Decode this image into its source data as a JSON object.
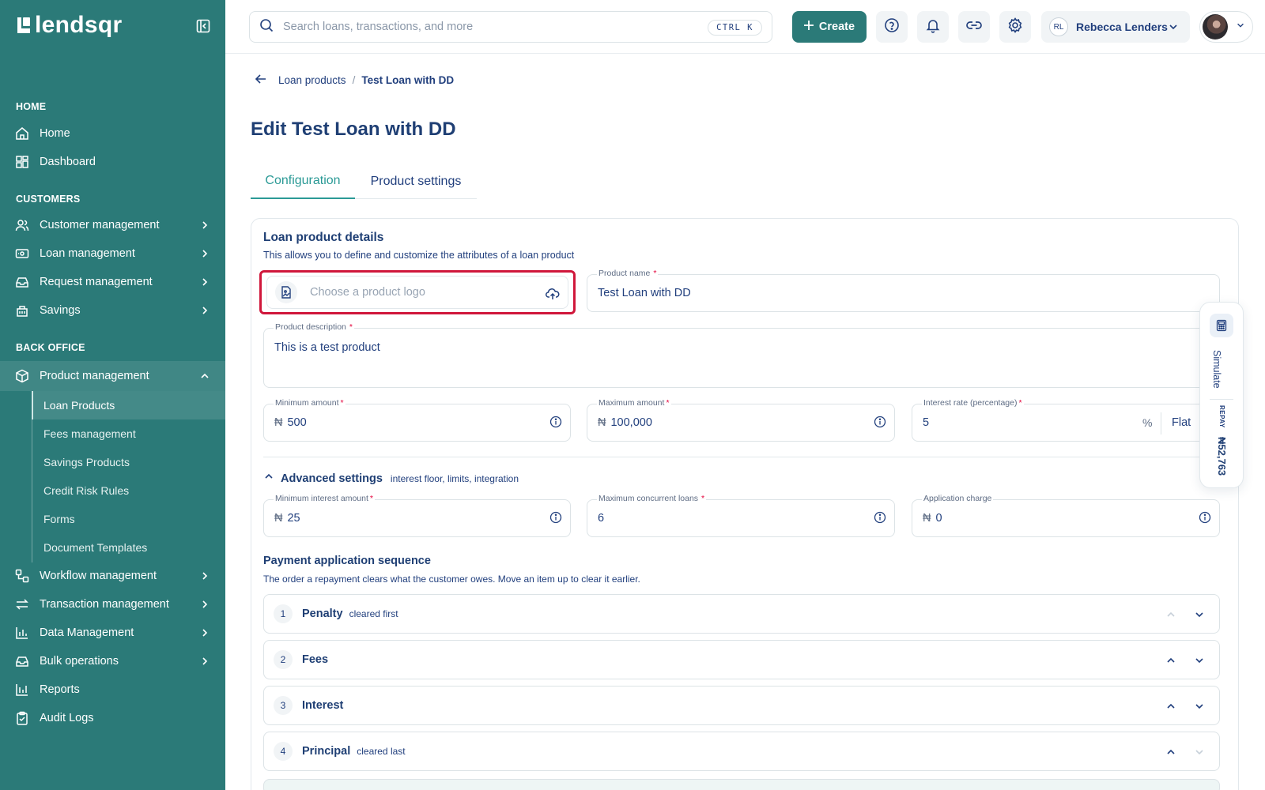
{
  "brand": {
    "name": "lendsqr"
  },
  "sidebar": {
    "sections": {
      "home": "HOME",
      "customers": "CUSTOMERS",
      "back_office": "BACK OFFICE"
    },
    "home_items": [
      {
        "label": "Home",
        "icon": "home-icon"
      },
      {
        "label": "Dashboard",
        "icon": "dashboard-icon"
      }
    ],
    "customer_items": [
      {
        "label": "Customer management",
        "icon": "users-icon"
      },
      {
        "label": "Loan management",
        "icon": "cash-icon"
      },
      {
        "label": "Request management",
        "icon": "inbox-icon"
      },
      {
        "label": "Savings",
        "icon": "piggy-bank-icon"
      }
    ],
    "product_management": {
      "label": "Product management",
      "icon": "box-icon"
    },
    "product_sub_items": [
      {
        "label": "Loan Products",
        "active": true
      },
      {
        "label": "Fees management"
      },
      {
        "label": "Savings Products"
      },
      {
        "label": "Credit Risk Rules"
      },
      {
        "label": "Forms"
      },
      {
        "label": "Document Templates"
      }
    ],
    "back_office_items": [
      {
        "label": "Workflow management",
        "icon": "workflow-icon"
      },
      {
        "label": "Transaction management",
        "icon": "arrows-icon"
      },
      {
        "label": "Data Management",
        "icon": "bar-chart-icon"
      },
      {
        "label": "Bulk operations",
        "icon": "inbox-icon"
      },
      {
        "label": "Reports",
        "icon": "report-icon"
      },
      {
        "label": "Audit Logs",
        "icon": "clipboard-icon"
      }
    ]
  },
  "topbar": {
    "search_placeholder": "Search loans, transactions, and more",
    "shortcut": "CTRL K",
    "create_label": "Create",
    "user_initials": "RL",
    "user_name": "Rebecca Lenders"
  },
  "breadcrumb": {
    "parent": "Loan products",
    "separator": "/",
    "current": "Test Loan with DD"
  },
  "page_title": "Edit Test Loan with DD",
  "tabs": [
    {
      "label": "Configuration",
      "active": true
    },
    {
      "label": "Product settings"
    }
  ],
  "details": {
    "title": "Loan product details",
    "subtitle": "This allows you to define and customize the attributes of a loan product",
    "logo_placeholder": "Choose a product logo",
    "product_name_label": "Product name",
    "product_name": "Test Loan with DD",
    "description_label": "Product description",
    "description": "This is a test product",
    "currency": "₦",
    "min_amount_label": "Minimum amount",
    "min_amount": "500",
    "max_amount_label": "Maximum amount",
    "max_amount": "100,000",
    "interest_label": "Interest rate (percentage)",
    "interest_rate": "5",
    "interest_unit": "%",
    "interest_type": "Flat",
    "required_mark": "*"
  },
  "advanced": {
    "title": "Advanced settings",
    "hint": "interest floor, limits, integration",
    "min_interest_label": "Minimum interest amount",
    "min_interest": "25",
    "max_loans_label": "Maximum concurrent loans",
    "max_loans": "6",
    "app_charge_label": "Application charge",
    "app_charge": "0"
  },
  "payment_sequence": {
    "title": "Payment application sequence",
    "subtitle": "The order a repayment clears what the customer owes. Move an item up to clear it earlier.",
    "items": [
      {
        "num": "1",
        "label": "Penalty",
        "note": "cleared first"
      },
      {
        "num": "2",
        "label": "Fees",
        "note": ""
      },
      {
        "num": "3",
        "label": "Interest",
        "note": ""
      },
      {
        "num": "4",
        "label": "Principal",
        "note": "cleared last"
      }
    ]
  },
  "simulate": {
    "label": "Simulate",
    "repay_label": "REPAY",
    "repay_amount": "₦52,763"
  },
  "colors": {
    "sidebar": "#2B7A78",
    "accent": "#2B9A96",
    "highlight": "#D0173B",
    "text": "#213F7D"
  }
}
